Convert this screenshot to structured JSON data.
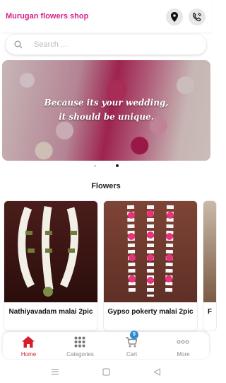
{
  "header": {
    "title": "Murugan flowers shop",
    "location_icon": "location-pin-icon",
    "phone_icon": "phone-icon"
  },
  "search": {
    "placeholder": "Search ...",
    "icon": "search-icon"
  },
  "banner": {
    "line1": "Because its your wedding,",
    "line2": "it should be unique.",
    "slide_count": 2,
    "active_slide": 2
  },
  "section": {
    "title": "Flowers"
  },
  "products": [
    {
      "name": "Nathiyavadam malai 2pic"
    },
    {
      "name": "Gypso  pokerty malai 2pic"
    },
    {
      "name": "F"
    }
  ],
  "bottom_nav": {
    "items": [
      {
        "label": "Home",
        "icon": "home-icon",
        "active": true
      },
      {
        "label": "Categories",
        "icon": "grid-icon",
        "active": false
      },
      {
        "label": "Cart",
        "icon": "cart-icon",
        "active": false,
        "badge": "0"
      },
      {
        "label": "More",
        "icon": "more-icon",
        "active": false
      }
    ]
  },
  "colors": {
    "brand": "#d61f8a",
    "active_nav": "#d61f2b",
    "badge": "#2c8bd3"
  }
}
